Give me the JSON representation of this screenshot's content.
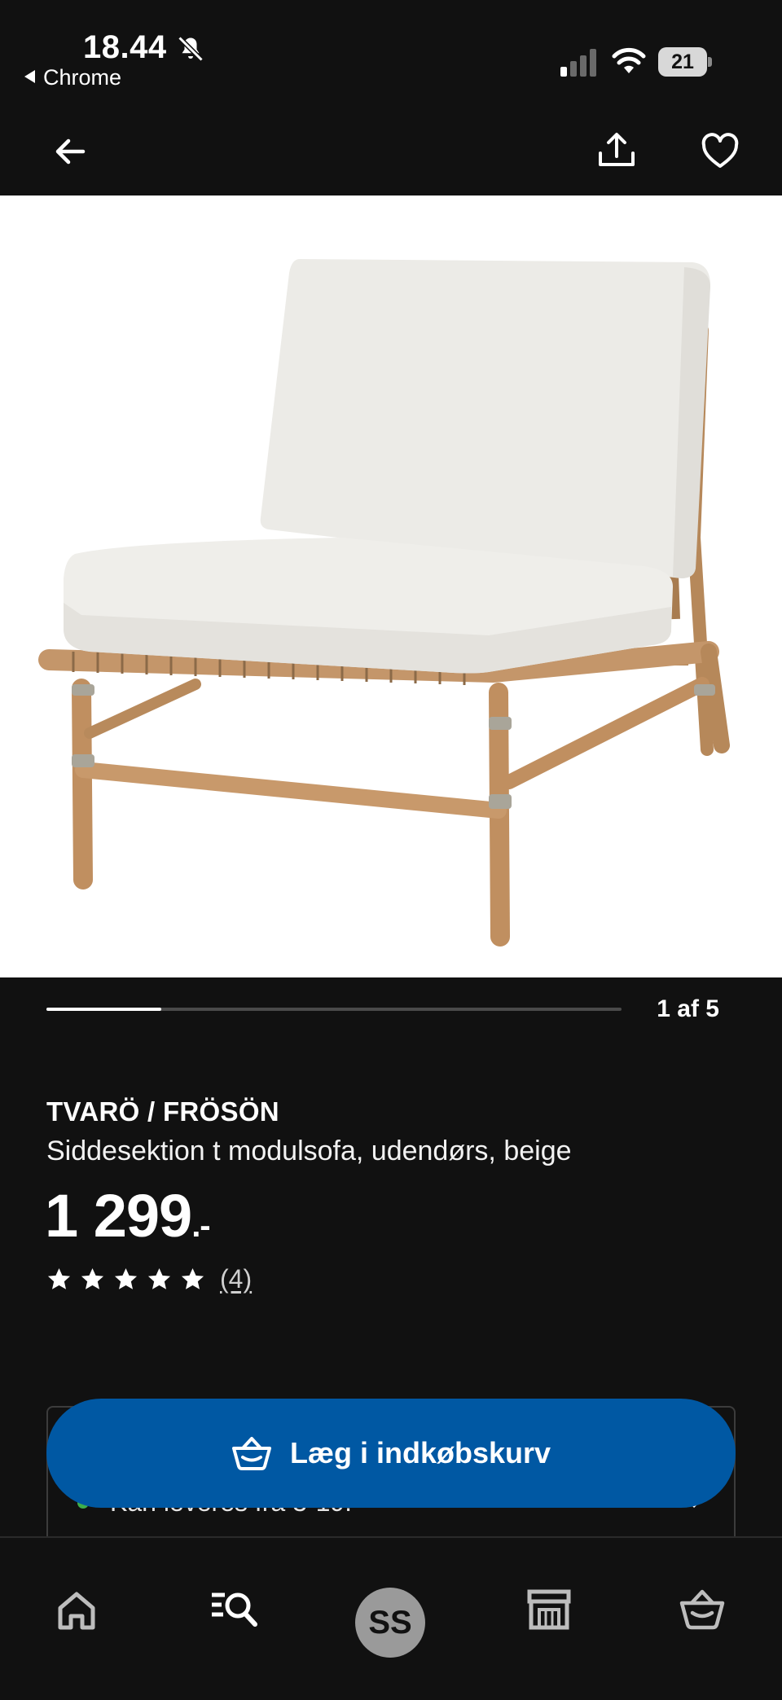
{
  "status_bar": {
    "time": "18.44",
    "back_app": "Chrome",
    "battery": "21",
    "icons": [
      "bell-slash-icon",
      "signal-icon",
      "wifi-icon",
      "battery-icon"
    ]
  },
  "top_nav": {
    "icons": [
      "arrow-left-icon",
      "share-icon",
      "heart-icon"
    ]
  },
  "carousel": {
    "label": "1 af 5",
    "progress": 0.2
  },
  "product": {
    "name": "TVARÖ / FRÖSÖN",
    "description": "Siddesektion t modulsofa, udendørs, beige",
    "price": "1 299",
    "price_suffix": ".-",
    "rating": 5,
    "review_count": "(4)"
  },
  "availability": {
    "text": "Kan leveres fra 3-19."
  },
  "cart_button": {
    "label": "Læg i indkøbskurv",
    "icon": "basket-icon",
    "color": "#0058a3"
  },
  "bottom_nav": {
    "items": [
      "home-icon",
      "search-list-icon",
      "profile-avatar",
      "store-icon",
      "basket-icon"
    ],
    "avatar_initials": "SS"
  }
}
